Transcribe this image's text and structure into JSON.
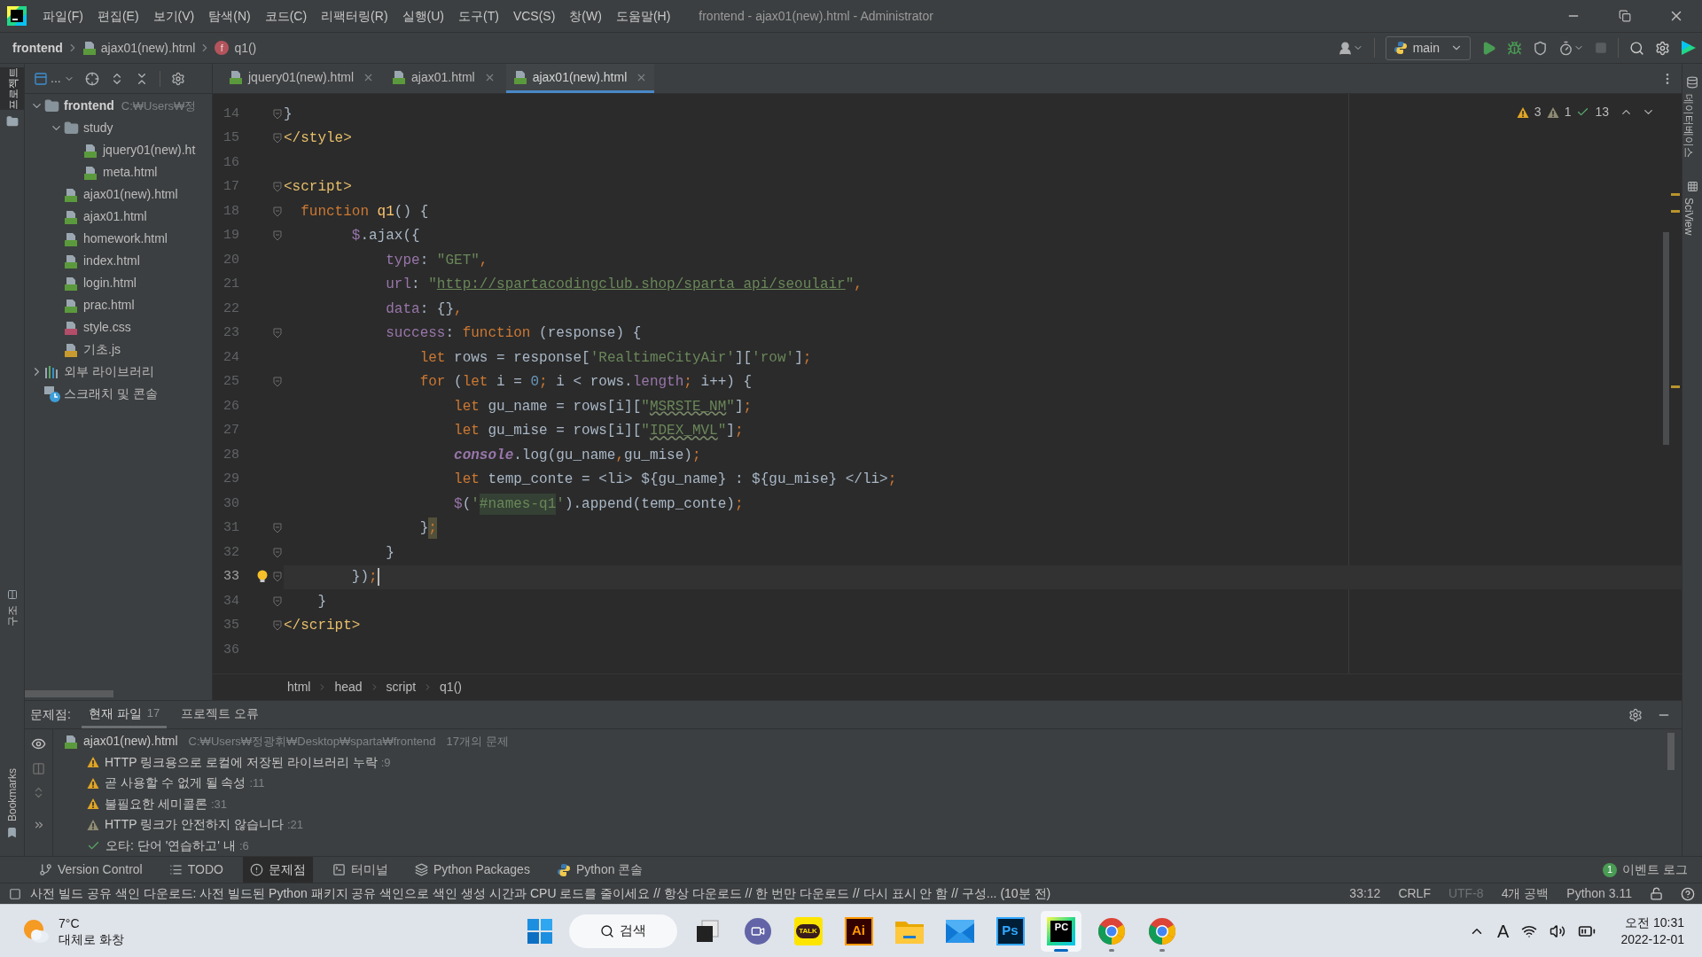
{
  "title_bar": {
    "menu": [
      "파일(F)",
      "편집(E)",
      "보기(V)",
      "탐색(N)",
      "코드(C)",
      "리팩터링(R)",
      "실행(U)",
      "도구(T)",
      "VCS(S)",
      "창(W)",
      "도움말(H)"
    ],
    "title": "frontend - ajax01(new).html - Administrator"
  },
  "nav_bar": {
    "crumbs": [
      {
        "kind": "project",
        "text": "frontend"
      },
      {
        "kind": "html",
        "text": "ajax01(new).html"
      },
      {
        "kind": "function",
        "icon_letter": "f",
        "text": "q1()"
      }
    ],
    "run_config": "main"
  },
  "left_strip": [
    {
      "text": "프로젝트",
      "selected": true
    },
    {
      "text": "구조",
      "selected": false
    },
    {
      "text": "Bookmarks",
      "selected": false
    }
  ],
  "right_strip": [
    {
      "text": "데이터베이스",
      "selected": false
    },
    {
      "text": "SciView",
      "selected": false
    }
  ],
  "project_panel": {
    "view_label": "...",
    "tree": [
      {
        "kind": "folder",
        "name": "frontend",
        "path": "C:₩Users₩정",
        "expanded": true,
        "children": [
          {
            "kind": "folder",
            "name": "study",
            "expanded": true,
            "children": [
              {
                "kind": "html",
                "name": "jquery01(new).ht"
              },
              {
                "kind": "html",
                "name": "meta.html"
              }
            ]
          },
          {
            "kind": "html",
            "name": "ajax01(new).html"
          },
          {
            "kind": "html",
            "name": "ajax01.html"
          },
          {
            "kind": "html",
            "name": "homework.html"
          },
          {
            "kind": "html",
            "name": "index.html"
          },
          {
            "kind": "html",
            "name": "login.html"
          },
          {
            "kind": "html",
            "name": "prac.html"
          },
          {
            "kind": "css",
            "name": "style.css"
          },
          {
            "kind": "js",
            "name": "기초.js"
          }
        ]
      },
      {
        "kind": "library",
        "name": "외부 라이브러리",
        "expanded": false
      },
      {
        "kind": "scratch",
        "name": "스크래치 및 콘솔"
      }
    ]
  },
  "editor": {
    "tabs": [
      {
        "text": "jquery01(new).html",
        "selected": false
      },
      {
        "text": "ajax01.html",
        "selected": false
      },
      {
        "text": "ajax01(new).html",
        "selected": true
      }
    ],
    "inspections": {
      "warnings": "3",
      "weak_warnings": "1",
      "passed": "13"
    },
    "lines": [
      {
        "number": "14",
        "fold": true,
        "current": false,
        "bulb": false,
        "tokens": [
          {
            "kind": "plain",
            "text": "}"
          }
        ]
      },
      {
        "number": "15",
        "fold": true,
        "current": false,
        "bulb": false,
        "tokens": [
          {
            "kind": "tag",
            "text": "</style>"
          }
        ]
      },
      {
        "number": "16",
        "fold": false,
        "current": false,
        "bulb": false
      },
      {
        "number": "17",
        "fold": true,
        "current": false,
        "bulb": false,
        "tokens": [
          {
            "kind": "tag",
            "text": "<script>"
          }
        ]
      },
      {
        "number": "18",
        "fold": true,
        "current": false,
        "bulb": false,
        "tokens": [
          {
            "kind": "keyword",
            "text": "  function"
          },
          {
            "kind": "function",
            "text": " q1"
          },
          {
            "kind": "plain",
            "text": "() {"
          }
        ]
      },
      {
        "number": "19",
        "fold": true,
        "current": false,
        "bulb": false,
        "tokens": [
          {
            "kind": "property",
            "text": "        $"
          },
          {
            "kind": "plain",
            "text": ".ajax({"
          }
        ]
      },
      {
        "number": "20",
        "fold": false,
        "current": false,
        "bulb": false,
        "tokens": [
          {
            "kind": "property",
            "text": "            type"
          },
          {
            "kind": "plain",
            "text": ": "
          },
          {
            "kind": "string",
            "text": "\"GET\""
          },
          {
            "kind": "keyword",
            "text": ","
          }
        ]
      },
      {
        "number": "21",
        "fold": false,
        "current": false,
        "bulb": false,
        "tokens": [
          {
            "kind": "property",
            "text": "            url"
          },
          {
            "kind": "plain",
            "text": ": "
          },
          {
            "kind": "string",
            "text": "\""
          },
          {
            "kind": "url",
            "text": "http://spartacodingclub.shop/sparta_api/seoulair"
          },
          {
            "kind": "string",
            "text": "\""
          },
          {
            "kind": "keyword",
            "text": ","
          }
        ]
      },
      {
        "number": "22",
        "fold": false,
        "current": false,
        "bulb": false,
        "tokens": [
          {
            "kind": "property",
            "text": "            data"
          },
          {
            "kind": "plain",
            "text": ": {}"
          },
          {
            "kind": "keyword",
            "text": ","
          }
        ]
      },
      {
        "number": "23",
        "fold": true,
        "current": false,
        "bulb": false,
        "tokens": [
          {
            "kind": "property",
            "text": "            success"
          },
          {
            "kind": "plain",
            "text": ": "
          },
          {
            "kind": "keyword",
            "text": "function"
          },
          {
            "kind": "plain",
            "text": " (response) {"
          }
        ]
      },
      {
        "number": "24",
        "fold": false,
        "current": false,
        "bulb": false,
        "tokens": [
          {
            "kind": "keyword",
            "text": "                let"
          },
          {
            "kind": "plain",
            "text": " rows = response["
          },
          {
            "kind": "string",
            "text": "'RealtimeCityAir'"
          },
          {
            "kind": "plain",
            "text": "]["
          },
          {
            "kind": "string",
            "text": "'row'"
          },
          {
            "kind": "plain",
            "text": "]"
          },
          {
            "kind": "keyword",
            "text": ";"
          }
        ]
      },
      {
        "number": "25",
        "fold": true,
        "current": false,
        "bulb": false,
        "tokens": [
          {
            "kind": "keyword",
            "text": "                for"
          },
          {
            "kind": "plain",
            "text": " ("
          },
          {
            "kind": "keyword",
            "text": "let"
          },
          {
            "kind": "plain",
            "text": " i = "
          },
          {
            "kind": "number",
            "text": "0"
          },
          {
            "kind": "keyword",
            "text": ";"
          },
          {
            "kind": "plain",
            "text": " i < rows."
          },
          {
            "kind": "property",
            "text": "length"
          },
          {
            "kind": "keyword",
            "text": ";"
          },
          {
            "kind": "plain",
            "text": " i++) {"
          }
        ]
      },
      {
        "number": "26",
        "fold": false,
        "current": false,
        "bulb": false,
        "tokens": [
          {
            "kind": "keyword",
            "text": "                    let"
          },
          {
            "kind": "plain",
            "text": " gu_name = rows[i]["
          },
          {
            "kind": "string",
            "text": "\""
          },
          {
            "kind": "typo",
            "text": "MSRSTE_NM"
          },
          {
            "kind": "string",
            "text": "\""
          },
          {
            "kind": "plain",
            "text": "]"
          },
          {
            "kind": "keyword",
            "text": ";"
          }
        ]
      },
      {
        "number": "27",
        "fold": false,
        "current": false,
        "bulb": false,
        "tokens": [
          {
            "kind": "keyword",
            "text": "                    let"
          },
          {
            "kind": "plain",
            "text": " gu_mise = rows[i]["
          },
          {
            "kind": "string",
            "text": "\""
          },
          {
            "kind": "typo",
            "text": "IDEX_MVL"
          },
          {
            "kind": "string",
            "text": "\""
          },
          {
            "kind": "plain",
            "text": "]"
          },
          {
            "kind": "keyword",
            "text": ";"
          }
        ]
      },
      {
        "number": "28",
        "fold": false,
        "current": false,
        "bulb": false,
        "tokens": [
          {
            "kind": "console",
            "text": "                    console"
          },
          {
            "kind": "plain",
            "text": ".log(gu_name"
          },
          {
            "kind": "keyword",
            "text": ","
          },
          {
            "kind": "plain",
            "text": "gu_mise)"
          },
          {
            "kind": "keyword",
            "text": ";"
          }
        ]
      },
      {
        "number": "29",
        "fold": false,
        "current": false,
        "bulb": false,
        "tokens": [
          {
            "kind": "keyword",
            "text": "                    let"
          },
          {
            "kind": "plain",
            "text": " temp_conte = <li> ${gu_name} : ${gu_mise} </li>"
          },
          {
            "kind": "keyword",
            "text": ";"
          }
        ]
      },
      {
        "number": "30",
        "fold": false,
        "current": false,
        "bulb": false,
        "tokens": [
          {
            "kind": "property",
            "text": "                    $"
          },
          {
            "kind": "plain",
            "text": "("
          },
          {
            "kind": "string",
            "text": "'"
          },
          {
            "kind": "selector",
            "text": "#names-q1"
          },
          {
            "kind": "string",
            "text": "'"
          },
          {
            "kind": "plain",
            "text": ").append(temp_conte)"
          },
          {
            "kind": "keyword",
            "text": ";"
          }
        ]
      },
      {
        "number": "31",
        "fold": true,
        "current": false,
        "bulb": false,
        "tokens": [
          {
            "kind": "plain",
            "text": "                }"
          },
          {
            "kind": "highlight",
            "text": ";"
          }
        ]
      },
      {
        "number": "32",
        "fold": true,
        "current": false,
        "bulb": false,
        "tokens": [
          {
            "kind": "plain",
            "text": "            }"
          }
        ]
      },
      {
        "number": "33",
        "fold": true,
        "current": true,
        "bulb": true,
        "tokens": [
          {
            "kind": "plain",
            "text": "        })"
          },
          {
            "kind": "keyword",
            "text": ";"
          }
        ]
      },
      {
        "number": "34",
        "fold": true,
        "current": false,
        "bulb": false,
        "tokens": [
          {
            "kind": "plain",
            "text": "    }"
          }
        ]
      },
      {
        "number": "35",
        "fold": true,
        "current": false,
        "bulb": false,
        "tokens": [
          {
            "kind": "tag",
            "text": "</script>"
          }
        ]
      },
      {
        "number": "36",
        "fold": false,
        "current": false,
        "bulb": false
      }
    ],
    "breadcrumbs": [
      "html",
      "head",
      "script",
      "q1()"
    ]
  },
  "problems": {
    "label": "문제점:",
    "tabs": [
      {
        "text": "현재 파일",
        "count": "17",
        "selected": true
      },
      {
        "text": "프로젝트 오류",
        "selected": false
      }
    ],
    "file": {
      "name": "ajax01(new).html",
      "path": "C:₩Users₩정광휘₩Desktop₩sparta₩frontend",
      "count": "17개의 문제"
    },
    "items": [
      {
        "kind": "warning",
        "text": "HTTP 링크용으로 로컬에 저장된 라이브러리 누락",
        "line": ":9"
      },
      {
        "kind": "warning",
        "text": "곧 사용할 수 없게 될 속성",
        "line": ":11"
      },
      {
        "kind": "warning",
        "text": "불필요한 세미콜론",
        "line": ":31"
      },
      {
        "kind": "weak_warning",
        "text": "HTTP 링크가 안전하지 않습니다",
        "line": ":21"
      },
      {
        "kind": "typo",
        "text": "오타: 단어 '연습하고' 내",
        "line": ":6"
      }
    ]
  },
  "tool_windows": [
    {
      "kind": "vcs",
      "text": "Version Control",
      "selected": false
    },
    {
      "kind": "todo",
      "text": "TODO",
      "selected": false
    },
    {
      "kind": "problems",
      "text": "문제점",
      "selected": true
    },
    {
      "kind": "terminal",
      "text": "터미널",
      "selected": false
    },
    {
      "kind": "packages",
      "text": "Python Packages",
      "selected": false
    },
    {
      "kind": "console",
      "text": "Python 콘솔",
      "selected": false
    }
  ],
  "event_log": {
    "badge": "1",
    "text": "이벤트 로그"
  },
  "status_bar": {
    "message": "사전 빌드 공유 색인 다운로드: 사전 빌드된 Python 패키지 공유 색인으로 색인 생성 시간과 CPU 로드를 줄이세요 // 항상 다운로드 // 한 번만 다운로드 // 다시 표시 안 함 // 구성... (10분 전)",
    "items": [
      {
        "text": "33:12",
        "disabled": false
      },
      {
        "text": "CRLF",
        "disabled": false
      },
      {
        "text": "UTF-8",
        "disabled": true
      },
      {
        "text": "4개 공백",
        "disabled": false
      },
      {
        "text": "Python 3.11",
        "disabled": false
      }
    ]
  },
  "taskbar": {
    "weather": {
      "temp": "7°C",
      "text": "대체로 화창"
    },
    "search": "검색",
    "apps": [
      {
        "kind": "taskview",
        "selected": false,
        "running": false
      },
      {
        "kind": "chat",
        "selected": false,
        "running": false
      },
      {
        "kind": "kakao",
        "label": "TALK",
        "selected": false,
        "running": false
      },
      {
        "kind": "illustrator",
        "label": "Ai",
        "selected": false,
        "running": false
      },
      {
        "kind": "explorer",
        "selected": false,
        "running": false
      },
      {
        "kind": "mail",
        "selected": false,
        "running": false
      },
      {
        "kind": "photoshop",
        "label": "Ps",
        "selected": false,
        "running": false
      },
      {
        "kind": "pycharm",
        "label": "PC",
        "selected": true,
        "running": true
      },
      {
        "kind": "chrome",
        "selected": false,
        "running": true
      },
      {
        "kind": "chrome",
        "selected": false,
        "running": true
      }
    ],
    "ime": "A",
    "time": "오전 10:31",
    "date": "2022-12-01"
  }
}
